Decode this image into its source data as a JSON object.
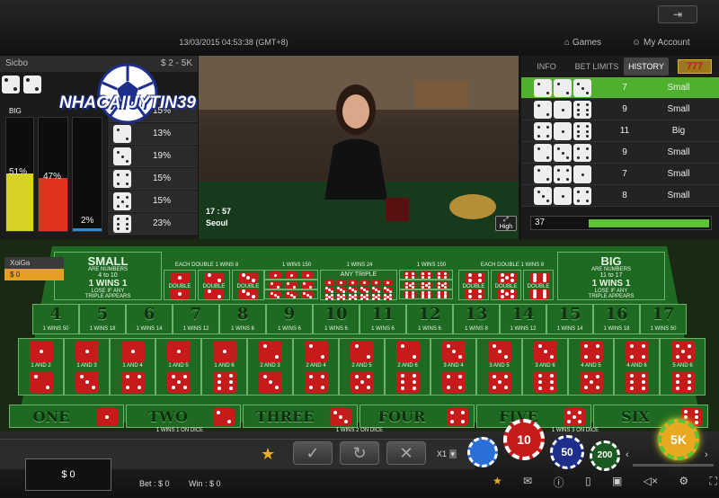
{
  "header": {
    "datetime": "13/03/2015 04:53:38 (GMT+8)",
    "nav_games": "Games",
    "nav_account": "My Account",
    "exit_icon": "exit-icon"
  },
  "left_panel": {
    "game": "Sicbo",
    "limits": "$ 2 - 5K",
    "big_label": "BIG",
    "big_pct": "51%",
    "small_pct": "47%",
    "triple_pct": "2%",
    "big_level": 0.51,
    "small_level": 0.47,
    "triple_level": 0.02,
    "face_stats": [
      "15%",
      "13%",
      "19%",
      "15%",
      "15%",
      "23%"
    ]
  },
  "watermark": "NHACAIUYTIN39",
  "video": {
    "timer": "17 : 57",
    "location": "Seoul",
    "quality": "High"
  },
  "right_panel": {
    "tabs": [
      "INFO",
      "BET LIMITS",
      "HISTORY"
    ],
    "history": [
      {
        "dice": [
          2,
          2,
          3
        ],
        "total": "7",
        "result": "Small"
      },
      {
        "dice": [
          2,
          1,
          6
        ],
        "total": "9",
        "result": "Small"
      },
      {
        "dice": [
          4,
          1,
          6
        ],
        "total": "11",
        "result": "Big"
      },
      {
        "dice": [
          2,
          3,
          4
        ],
        "total": "9",
        "result": "Small"
      },
      {
        "dice": [
          2,
          4,
          1
        ],
        "total": "7",
        "result": "Small"
      },
      {
        "dice": [
          3,
          1,
          4
        ],
        "total": "8",
        "result": "Small"
      }
    ],
    "round": "37"
  },
  "player": {
    "name": "XoiGa",
    "balance": "$ 0"
  },
  "table": {
    "small": {
      "title": "SMALL",
      "line1": "ARE NUMBERS",
      "line2": "4 to 10",
      "pays": "1 WINS 1",
      "note1": "LOSE IF ANY",
      "note2": "TRIPLE APPEARS"
    },
    "big": {
      "title": "BIG",
      "line1": "ARE NUMBERS",
      "line2": "11 to 17",
      "pays": "1 WINS 1",
      "note1": "LOSE IF ANY",
      "note2": "TRIPLE APPEARS"
    },
    "double_header": "EACH DOUBLE 1 WINS 8",
    "triple_header": "1 WINS 150",
    "any_triple": "ANY TRIPLE",
    "any_triple_pay": "1 WINS 24",
    "double_label": "DOUBLE",
    "totals": [
      {
        "n": "4",
        "pay": "1 WINS 50"
      },
      {
        "n": "5",
        "pay": "1 WINS 18"
      },
      {
        "n": "6",
        "pay": "1 WINS 14"
      },
      {
        "n": "7",
        "pay": "1 WINS 12"
      },
      {
        "n": "8",
        "pay": "1 WINS 8"
      },
      {
        "n": "9",
        "pay": "1 WINS 6"
      },
      {
        "n": "10",
        "pay": "1 WINS 6"
      },
      {
        "n": "11",
        "pay": "1 WINS 6"
      },
      {
        "n": "12",
        "pay": "1 WINS 6"
      },
      {
        "n": "13",
        "pay": "1 WINS 8"
      },
      {
        "n": "14",
        "pay": "1 WINS 12"
      },
      {
        "n": "15",
        "pay": "1 WINS 14"
      },
      {
        "n": "16",
        "pay": "1 WINS 18"
      },
      {
        "n": "17",
        "pay": "1 WINS 50"
      }
    ],
    "combos": [
      "1 AND 2",
      "1 AND 3",
      "1 AND 4",
      "1 AND 5",
      "1 AND 6",
      "2 AND 3",
      "2 AND 4",
      "2 AND 5",
      "2 AND 6",
      "3 AND 4",
      "3 AND 5",
      "3 AND 6",
      "4 AND 5",
      "4 AND 6",
      "5 AND 6"
    ],
    "singles": [
      "ONE",
      "TWO",
      "THREE",
      "FOUR",
      "FIVE",
      "SIX"
    ],
    "single_pay1": "1 WINS 1 ON DICE",
    "single_pay2": "1 WINS 2 ON DICE",
    "single_pay3": "1 WINS 3 ON DICE"
  },
  "bottom": {
    "balance": "$ 0",
    "bet_label": "Bet :",
    "bet_value": "$ 0",
    "win_label": "Win :",
    "win_value": "$ 0",
    "multiplier": "X1",
    "chips": [
      "10",
      "50",
      "200",
      "5K"
    ]
  },
  "colors": {
    "felt": "#1f6a22",
    "die": "#c61b1b",
    "accent": "#5cc236",
    "big_bar": "#d6d226",
    "small_bar": "#e0321c"
  }
}
